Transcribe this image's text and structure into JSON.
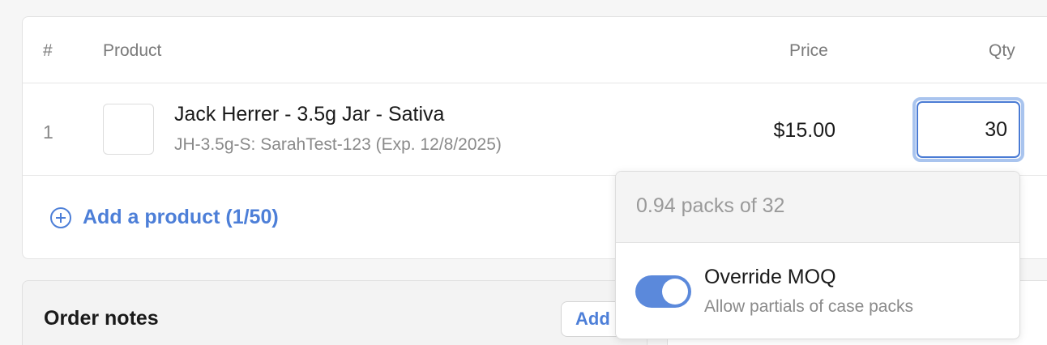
{
  "table": {
    "headers": {
      "num": "#",
      "product": "Product",
      "price": "Price",
      "qty": "Qty"
    },
    "rows": [
      {
        "index": "1",
        "name": "Jack Herrer - 3.5g Jar - Sativa",
        "subtitle": "JH-3.5g-S: SarahTest-123 (Exp. 12/8/2025)",
        "price": "$15.00",
        "qty": "30"
      }
    ],
    "add_product_label": "Add a product (1/50)"
  },
  "order_notes": {
    "title": "Order notes",
    "add_label": "Add"
  },
  "moq_popover": {
    "packs_text": "0.94 packs of 32",
    "override_title": "Override MOQ",
    "override_subtitle": "Allow partials of case packs",
    "override_enabled": true,
    "toggle_color": "#5b89db"
  },
  "colors": {
    "accent": "#4d7fd8"
  }
}
